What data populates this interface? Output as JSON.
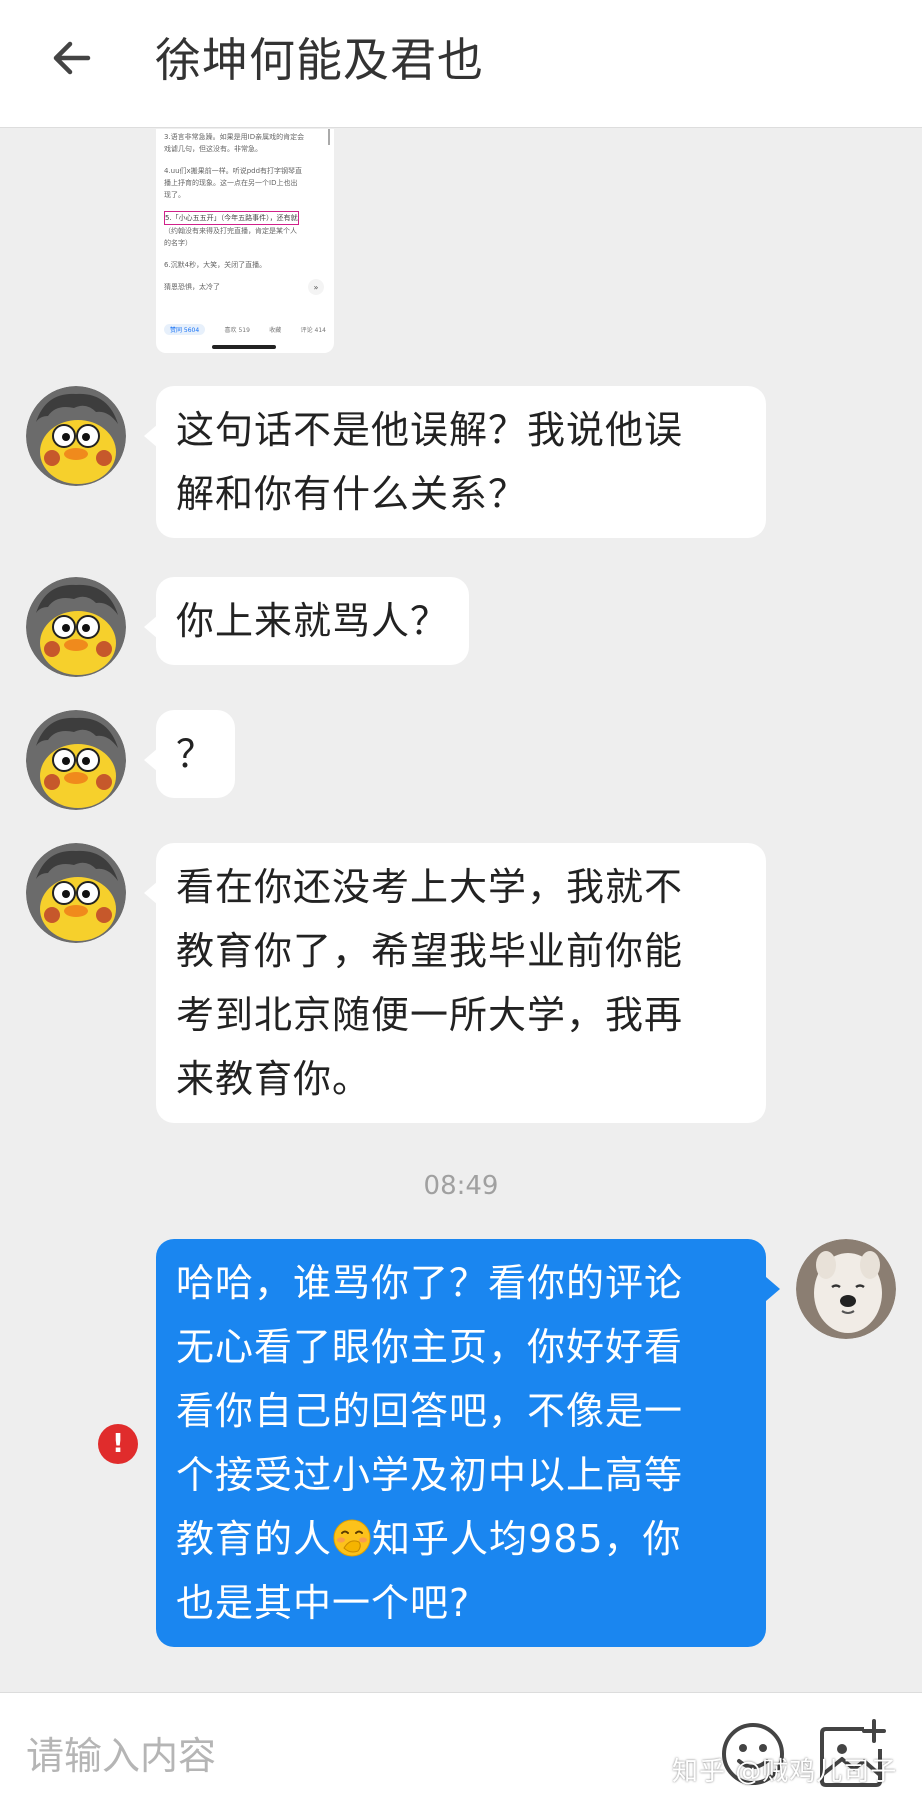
{
  "header": {
    "title": "徐坤何能及君也"
  },
  "screenshot_preview": {
    "lines": [
      "3.语言非常急躁。如果是用ID亲属戏的肯定会",
      "戏谑几句，但这没有。非常急。",
      "",
      "4.uu们x搬果前一样。听说pdd有打字钢琴直",
      "播上抒育的现象。这一点在另一个ID上也出",
      "现了。",
      "",
      "5.「小心五五开」（今年五路事件），还有就",
      "（约翰没有来得及打完直播，肯定是某个人",
      "的名字）",
      "",
      "6.沉默4秒，大笑，关闭了直播。",
      "",
      "猜恩恐惧，太冷了"
    ],
    "chip": "赞同 5604",
    "actions": [
      "喜欢 519",
      "收藏",
      "评论 414"
    ]
  },
  "messages": [
    {
      "side": "left",
      "text": "这句话不是他误解？我说他误\n解和你有什么关系？"
    },
    {
      "side": "left",
      "text": "你上来就骂人？"
    },
    {
      "side": "left",
      "text": "？"
    },
    {
      "side": "left",
      "text": "看在你还没考上大学，我就不\n教育你了，希望我毕业前你能\n考到北京随便一所大学，我再\n来教育你。"
    }
  ],
  "timestamp": "08:49",
  "my_message": {
    "part1": "哈哈，谁骂你了？看你的评论\n无心看了眼你主页，你好好看\n看你自己的回答吧，不像是一\n个接受过小学及初中以上高等\n教育的人",
    "emoji": "face-with-hand-over-mouth-emoji",
    "part2": "知乎人均985，你\n也是其中一个吧?",
    "status": "failed",
    "error_badge": "!"
  },
  "input": {
    "placeholder": "请输入内容"
  },
  "watermark": "知乎 @贼鸡儿司子",
  "colors": {
    "header_bg": "#ffffff",
    "chat_bg": "#eeeeee",
    "my_bubble": "#1a86f0",
    "their_bubble": "#ffffff",
    "error": "#e02c2c"
  },
  "icons": [
    "back-arrow-icon",
    "emoji-icon",
    "add-image-icon"
  ]
}
